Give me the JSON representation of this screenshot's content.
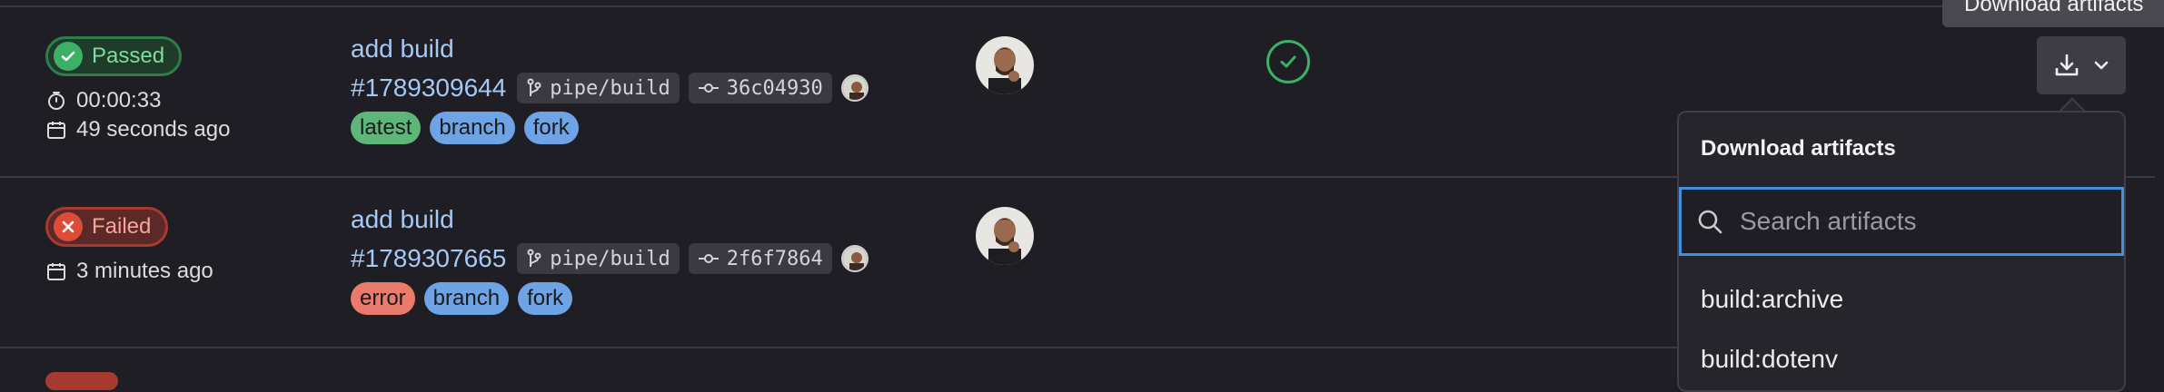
{
  "pipelines": [
    {
      "status": "Passed",
      "duration": "00:00:33",
      "time_ago": "49 seconds ago",
      "title": "add build",
      "id": "#1789309644",
      "ref": "pipe/build",
      "commit": "36c04930",
      "labels": [
        "latest",
        "branch",
        "fork"
      ]
    },
    {
      "status": "Failed",
      "time_ago": "3 minutes ago",
      "title": "add build",
      "id": "#1789307665",
      "ref": "pipe/build",
      "commit": "2f6f7864",
      "labels": [
        "error",
        "branch",
        "fork"
      ]
    }
  ],
  "tooltip": "Download artifacts",
  "dropdown": {
    "title": "Download artifacts",
    "search_placeholder": "Search artifacts",
    "items": [
      "build:archive",
      "build:dotenv"
    ]
  },
  "colors": {
    "passed": "#3cb166",
    "failed": "#dd4b39",
    "link": "#a6c8f5",
    "focus": "#428fdc"
  },
  "icons": [
    "check-circle-icon",
    "close-circle-icon",
    "timer-icon",
    "calendar-icon",
    "branch-icon",
    "commit-icon",
    "download-icon",
    "chevron-down-icon",
    "search-icon"
  ]
}
